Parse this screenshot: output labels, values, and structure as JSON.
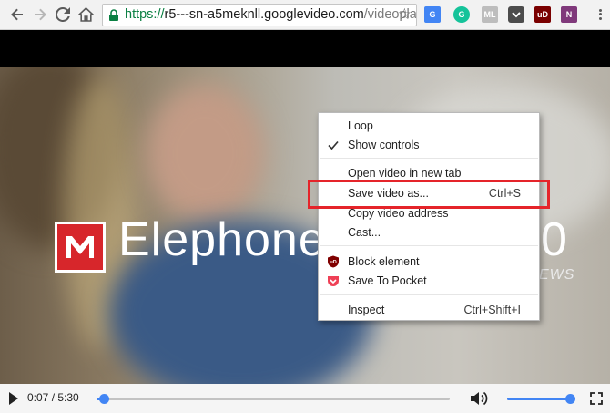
{
  "browser": {
    "url_scheme": "https://",
    "url_host": "r5---sn-a5meknll.googlevideo.com",
    "url_path": "/videoplayback",
    "extensions": [
      {
        "name": "google-translate-icon",
        "text": "G",
        "color": "#4285f4"
      },
      {
        "name": "grammarly-icon",
        "text": "G",
        "color": "#15c39a"
      },
      {
        "name": "ml-extension-icon",
        "text": "ML",
        "color": "#bdbdbd"
      },
      {
        "name": "pocket-icon",
        "text": "",
        "color": "#4c4c4c"
      },
      {
        "name": "ublock-icon",
        "text": "uD",
        "color": "#7a0000"
      },
      {
        "name": "onenote-icon",
        "text": "N",
        "color": "#80397b"
      }
    ]
  },
  "video": {
    "logo_text": "Elephone",
    "logo_tail": "0",
    "logo_sub": "EWS"
  },
  "controls": {
    "current_time": "0:07",
    "duration": "5:30",
    "progress_fraction": 0.021,
    "volume_fraction": 0.98
  },
  "context_menu": {
    "items": [
      {
        "label": "Loop",
        "shortcut": "",
        "icon": ""
      },
      {
        "label": "Show controls",
        "shortcut": "",
        "icon": "check-icon"
      },
      {
        "label": "Open video in new tab",
        "shortcut": "",
        "icon": ""
      },
      {
        "label": "Save video as...",
        "shortcut": "Ctrl+S",
        "icon": ""
      },
      {
        "label": "Copy video address",
        "shortcut": "",
        "icon": ""
      },
      {
        "label": "Cast...",
        "shortcut": "",
        "icon": ""
      },
      {
        "label": "Block element",
        "shortcut": "",
        "icon": "ublock-icon"
      },
      {
        "label": "Save To Pocket",
        "shortcut": "",
        "icon": "pocket-icon"
      },
      {
        "label": "Inspect",
        "shortcut": "Ctrl+Shift+I",
        "icon": ""
      }
    ]
  },
  "colors": {
    "accent": "#4285f4",
    "highlight_box": "#e5242a",
    "logo_red": "#d7262b"
  }
}
